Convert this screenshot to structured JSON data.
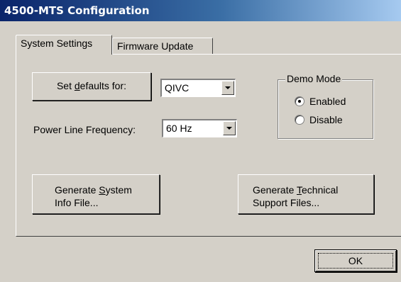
{
  "window": {
    "title": "4500-MTS Configuration"
  },
  "tabs": [
    {
      "label": "System Settings",
      "active": true
    },
    {
      "label": "Firmware Update",
      "active": false
    }
  ],
  "settings": {
    "set_defaults_button": {
      "pre": "Set ",
      "mnemonic": "d",
      "post": "efaults for:"
    },
    "defaults_select_value": "QIVC",
    "power_line_label": "Power Line Frequency:",
    "power_line_select_value": "60 Hz"
  },
  "demo_mode": {
    "legend": "Demo Mode",
    "options": [
      {
        "label": "Enabled",
        "selected": true
      },
      {
        "label": "Disable",
        "selected": false
      }
    ]
  },
  "buttons": {
    "gen_system_info": {
      "line1_pre": "Generate ",
      "line1_mnemonic": "S",
      "line1_post": "ystem",
      "line2": "Info File..."
    },
    "gen_tech_support": {
      "line1_pre": "Generate ",
      "line1_mnemonic": "T",
      "line1_post": "echnical",
      "line2": "Support Files..."
    },
    "ok": "OK"
  },
  "colors": {
    "title_bar_start": "#0a246a",
    "title_bar_end": "#a6caf0",
    "face": "#d4d0c8"
  }
}
